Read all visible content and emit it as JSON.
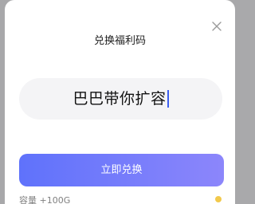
{
  "dialog": {
    "title": "兑换福利码",
    "close_icon": "close-icon",
    "code_input": {
      "value": "巴巴带你扩容"
    },
    "redeem_button": {
      "label": "立即兑换",
      "gradient_start": "#5f72fb",
      "gradient_end": "#8c86fb"
    }
  },
  "background": {
    "peek_text": "容量 +100G"
  }
}
